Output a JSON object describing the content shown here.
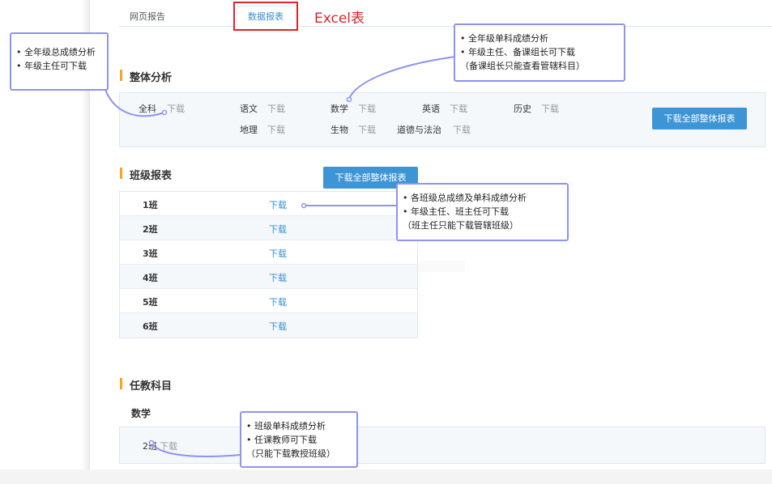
{
  "tabs": {
    "web_report": "网页报告",
    "data_report": "数据报表"
  },
  "excel_label": "Excel表",
  "overall": {
    "title": "整体分析",
    "subjects_row1": [
      {
        "name": "全科",
        "action": "下载"
      },
      {
        "name": "语文",
        "action": "下载"
      },
      {
        "name": "数学",
        "action": "下载"
      },
      {
        "name": "英语",
        "action": "下载"
      },
      {
        "name": "历史",
        "action": "下载"
      }
    ],
    "subjects_row2": [
      {
        "name": "地理",
        "action": "下载"
      },
      {
        "name": "生物",
        "action": "下载"
      },
      {
        "name": "道德与法治",
        "action": "下载"
      }
    ],
    "download_all": "下载全部整体报表"
  },
  "class_report": {
    "title": "班级报表",
    "download_all": "下载全部整体报表",
    "rows": [
      {
        "name": "1班",
        "action": "下载"
      },
      {
        "name": "2班",
        "action": "下载"
      },
      {
        "name": "3班",
        "action": "下载"
      },
      {
        "name": "4班",
        "action": "下载"
      },
      {
        "name": "5班",
        "action": "下载"
      },
      {
        "name": "6班",
        "action": "下载"
      }
    ]
  },
  "teaching": {
    "title": "任教科目",
    "subject": "数学",
    "items": [
      {
        "name": "2班",
        "action": "下载"
      }
    ]
  },
  "callouts": {
    "overall_total": [
      "• 全年级总成绩分析",
      "• 年级主任可下载"
    ],
    "single_subject": [
      "• 全年级单科成绩分析",
      "• 年级主任、备课组长可下载",
      "（备课组长只能查看管辖科目）"
    ],
    "class": [
      "• 各班级总成绩及单科成绩分析",
      "• 年级主任、班主任可下载",
      "（班主任只能下载管辖班级）"
    ],
    "teaching": [
      "• 班级单科成绩分析",
      "• 任课教师可下载",
      "（只能下载教授班级）"
    ]
  },
  "colors": {
    "accent_blue": "#3d95d6",
    "link_blue": "#3a8fd0",
    "red": "#d9262b",
    "callout_border": "#8f92f0",
    "section_mark": "#f5a623"
  }
}
